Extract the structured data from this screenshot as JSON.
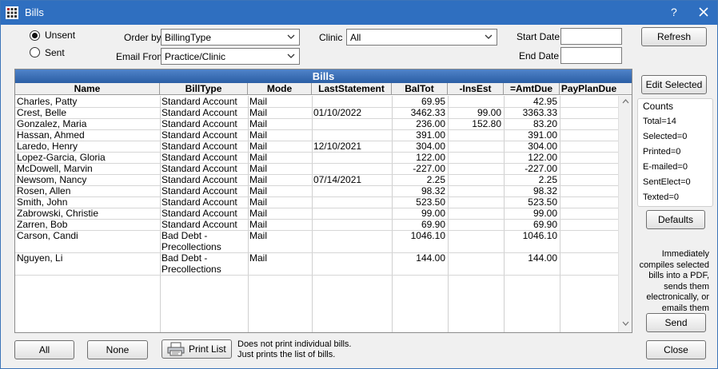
{
  "window": {
    "title": "Bills",
    "help": "?"
  },
  "filters": {
    "radio_unsent": "Unsent",
    "radio_sent": "Sent",
    "order_by_label": "Order by",
    "order_by_value": "BillingType",
    "email_from_label": "Email From",
    "email_from_value": "Practice/Clinic",
    "clinic_label": "Clinic",
    "clinic_value": "All",
    "start_date_label": "Start Date",
    "end_date_label": "End Date",
    "start_date_value": "",
    "end_date_value": ""
  },
  "grid": {
    "title": "Bills",
    "columns": [
      "Name",
      "BillType",
      "Mode",
      "LastStatement",
      "BalTot",
      "-InsEst",
      "=AmtDue",
      "PayPlanDue"
    ],
    "rows": [
      {
        "name": "Charles, Patty",
        "billtype": "Standard Account",
        "billtype2": "",
        "mode": "Mail",
        "last": "",
        "baltot": "69.95",
        "insest": "",
        "amtdue": "42.95",
        "payplan": ""
      },
      {
        "name": "Crest, Belle",
        "billtype": "Standard Account",
        "billtype2": "",
        "mode": "Mail",
        "last": "01/10/2022",
        "baltot": "3462.33",
        "insest": "99.00",
        "amtdue": "3363.33",
        "payplan": ""
      },
      {
        "name": "Gonzalez, Maria",
        "billtype": "Standard Account",
        "billtype2": "",
        "mode": "Mail",
        "last": "",
        "baltot": "236.00",
        "insest": "152.80",
        "amtdue": "83.20",
        "payplan": ""
      },
      {
        "name": "Hassan, Ahmed",
        "billtype": "Standard Account",
        "billtype2": "",
        "mode": "Mail",
        "last": "",
        "baltot": "391.00",
        "insest": "",
        "amtdue": "391.00",
        "payplan": ""
      },
      {
        "name": "Laredo, Henry",
        "billtype": "Standard Account",
        "billtype2": "",
        "mode": "Mail",
        "last": "12/10/2021",
        "baltot": "304.00",
        "insest": "",
        "amtdue": "304.00",
        "payplan": ""
      },
      {
        "name": "Lopez-Garcia, Gloria",
        "billtype": "Standard Account",
        "billtype2": "",
        "mode": "Mail",
        "last": "",
        "baltot": "122.00",
        "insest": "",
        "amtdue": "122.00",
        "payplan": ""
      },
      {
        "name": "McDowell, Marvin",
        "billtype": "Standard Account",
        "billtype2": "",
        "mode": "Mail",
        "last": "",
        "baltot": "-227.00",
        "insest": "",
        "amtdue": "-227.00",
        "payplan": ""
      },
      {
        "name": "Newsom, Nancy",
        "billtype": "Standard Account",
        "billtype2": "",
        "mode": "Mail",
        "last": "07/14/2021",
        "baltot": "2.25",
        "insest": "",
        "amtdue": "2.25",
        "payplan": ""
      },
      {
        "name": "Rosen, Allen",
        "billtype": "Standard Account",
        "billtype2": "",
        "mode": "Mail",
        "last": "",
        "baltot": "98.32",
        "insest": "",
        "amtdue": "98.32",
        "payplan": ""
      },
      {
        "name": "Smith, John",
        "billtype": "Standard Account",
        "billtype2": "",
        "mode": "Mail",
        "last": "",
        "baltot": "523.50",
        "insest": "",
        "amtdue": "523.50",
        "payplan": ""
      },
      {
        "name": "Zabrowski, Christie",
        "billtype": "Standard Account",
        "billtype2": "",
        "mode": "Mail",
        "last": "",
        "baltot": "99.00",
        "insest": "",
        "amtdue": "99.00",
        "payplan": ""
      },
      {
        "name": "Zarren, Bob",
        "billtype": "Standard Account",
        "billtype2": "",
        "mode": "Mail",
        "last": "",
        "baltot": "69.90",
        "insest": "",
        "amtdue": "69.90",
        "payplan": ""
      },
      {
        "name": "Carson, Candi",
        "billtype": "Bad Debt -",
        "billtype2": "Precollections",
        "mode": "Mail",
        "last": "",
        "baltot": "1046.10",
        "insest": "",
        "amtdue": "1046.10",
        "payplan": ""
      },
      {
        "name": "Nguyen, Li",
        "billtype": "Bad Debt -",
        "billtype2": "Precollections",
        "mode": "Mail",
        "last": "",
        "baltot": "144.00",
        "insest": "",
        "amtdue": "144.00",
        "payplan": ""
      }
    ]
  },
  "side": {
    "refresh": "Refresh",
    "edit_selected": "Edit Selected",
    "counts_title": "Counts",
    "counts": [
      "Total=14",
      "Selected=0",
      "Printed=0",
      "E-mailed=0",
      "SentElect=0",
      "Texted=0"
    ],
    "defaults": "Defaults",
    "send_note": [
      "Immediately",
      "compiles selected",
      "bills into a PDF,",
      "sends them",
      "electronically, or",
      "emails them"
    ],
    "send": "Send",
    "close": "Close"
  },
  "bottom": {
    "all": "All",
    "none": "None",
    "print_list": "Print List",
    "print_note_1": "Does not print individual bills.",
    "print_note_2": "Just prints the list of bills."
  },
  "icons": [
    "grid-app-icon",
    "close-icon",
    "chevron-down-icon",
    "printer-icon",
    "scroll-up-icon",
    "scroll-down-icon"
  ]
}
